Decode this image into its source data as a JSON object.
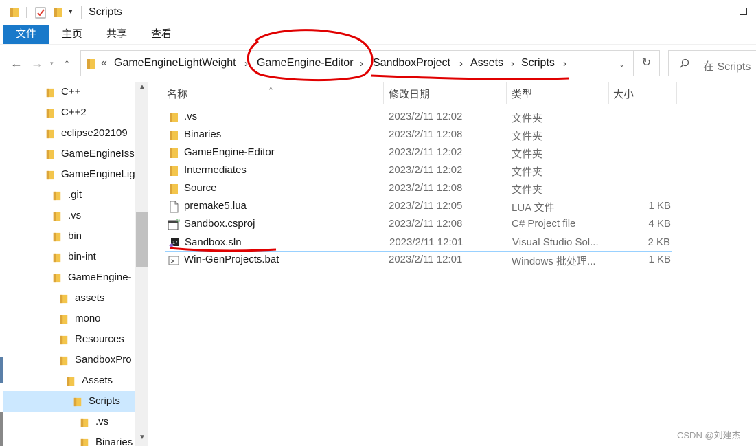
{
  "window": {
    "title": "Scripts"
  },
  "ribbon": {
    "tabs": [
      "文件",
      "主页",
      "共享",
      "查看"
    ]
  },
  "address": {
    "crumbs": [
      "GameEngineLightWeight",
      "GameEngine-Editor",
      "SandboxProject",
      "Assets",
      "Scripts"
    ],
    "overflow": "«",
    "search_placeholder": "在 Scripts"
  },
  "nav_tree": [
    {
      "label": "C++",
      "indent": 0
    },
    {
      "label": "C++2",
      "indent": 0
    },
    {
      "label": "eclipse202109",
      "indent": 0
    },
    {
      "label": "GameEngineIss",
      "indent": 0
    },
    {
      "label": "GameEngineLig",
      "indent": 0
    },
    {
      "label": ".git",
      "indent": 1
    },
    {
      "label": ".vs",
      "indent": 1
    },
    {
      "label": "bin",
      "indent": 1
    },
    {
      "label": "bin-int",
      "indent": 1
    },
    {
      "label": "GameEngine-",
      "indent": 1
    },
    {
      "label": "assets",
      "indent": 2
    },
    {
      "label": "mono",
      "indent": 2
    },
    {
      "label": "Resources",
      "indent": 2
    },
    {
      "label": "SandboxPro",
      "indent": 2
    },
    {
      "label": "Assets",
      "indent": 3
    },
    {
      "label": "Scripts",
      "indent": 4,
      "selected": true
    },
    {
      "label": ".vs",
      "indent": 5
    },
    {
      "label": "Binaries",
      "indent": 5
    }
  ],
  "columns": {
    "name": "名称",
    "date": "修改日期",
    "type": "类型",
    "size": "大小"
  },
  "files": [
    {
      "name": ".vs",
      "date": "2023/2/11 12:02",
      "type": "文件夹",
      "size": "",
      "icon": "folder-icon"
    },
    {
      "name": "Binaries",
      "date": "2023/2/11 12:08",
      "type": "文件夹",
      "size": "",
      "icon": "folder-icon"
    },
    {
      "name": "GameEngine-Editor",
      "date": "2023/2/11 12:02",
      "type": "文件夹",
      "size": "",
      "icon": "folder-icon"
    },
    {
      "name": "Intermediates",
      "date": "2023/2/11 12:02",
      "type": "文件夹",
      "size": "",
      "icon": "folder-icon"
    },
    {
      "name": "Source",
      "date": "2023/2/11 12:08",
      "type": "文件夹",
      "size": "",
      "icon": "folder-icon"
    },
    {
      "name": "premake5.lua",
      "date": "2023/2/11 12:05",
      "type": "LUA 文件",
      "size": "1 KB",
      "icon": "file-icon"
    },
    {
      "name": "Sandbox.csproj",
      "date": "2023/2/11 12:08",
      "type": "C# Project file",
      "size": "4 KB",
      "icon": "csproj-icon"
    },
    {
      "name": "Sandbox.sln",
      "date": "2023/2/11 12:01",
      "type": "Visual Studio Sol...",
      "size": "2 KB",
      "icon": "vs-solution-icon",
      "selected": true
    },
    {
      "name": "Win-GenProjects.bat",
      "date": "2023/2/11 12:01",
      "type": "Windows 批处理...",
      "size": "1 KB",
      "icon": "batch-file-icon"
    }
  ],
  "watermark": "CSDN @刘建杰",
  "colors": {
    "accent": "#1979ca",
    "folder": "#f3c54c",
    "annotation": "#e00000",
    "selection": "#cce8ff"
  }
}
